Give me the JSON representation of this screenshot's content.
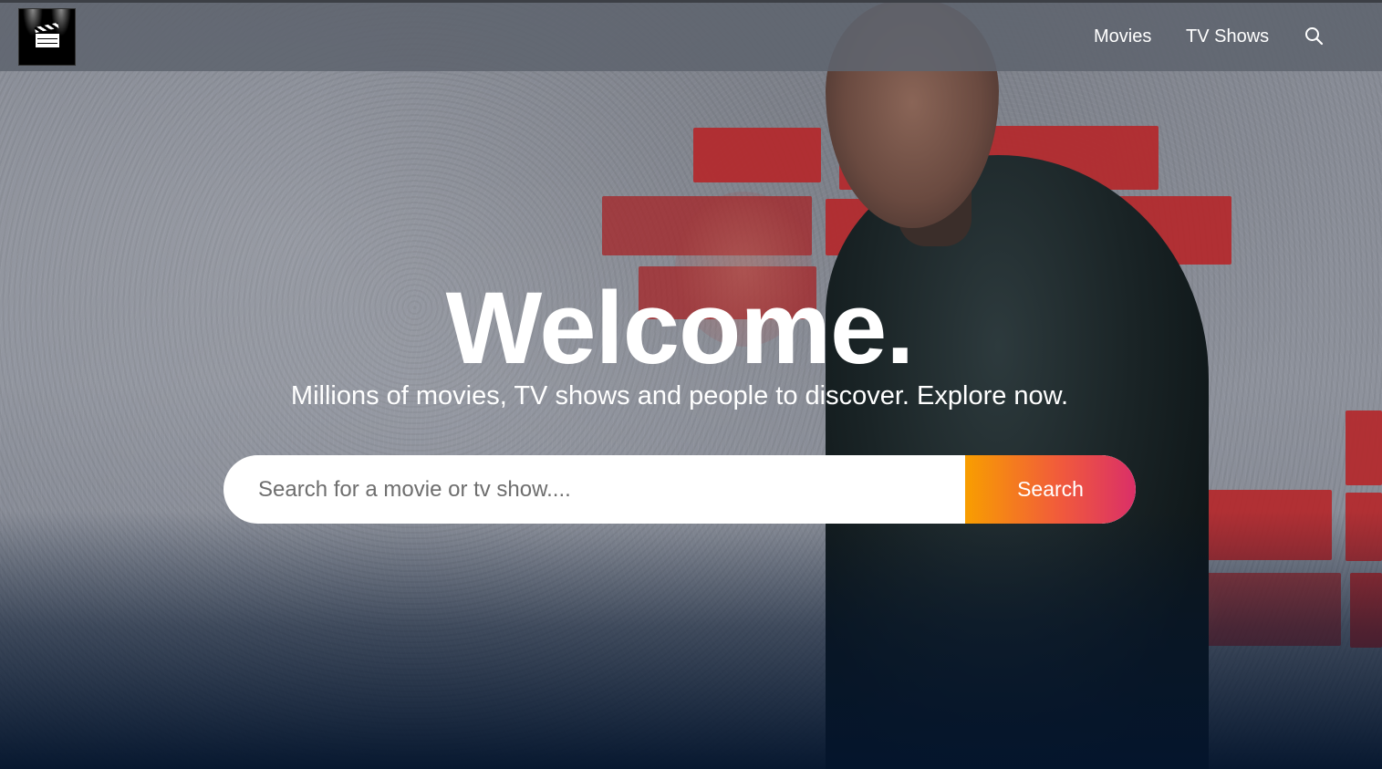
{
  "header": {
    "logo_alt": "clapperboard-logo",
    "nav": [
      {
        "label": "Movies"
      },
      {
        "label": "TV Shows"
      }
    ],
    "search_icon": "search-icon"
  },
  "hero": {
    "title": "Welcome.",
    "subtitle": "Millions of movies, TV shows and people to discover. Explore now.",
    "search": {
      "placeholder": "Search for a movie or tv show....",
      "value": "",
      "button_label": "Search"
    }
  },
  "colors": {
    "header_bg": "#5f646e",
    "button_gradient_start": "#f89e00",
    "button_gradient_end": "#da2f68",
    "page_bottom": "#04152d",
    "text": "#ffffff"
  }
}
